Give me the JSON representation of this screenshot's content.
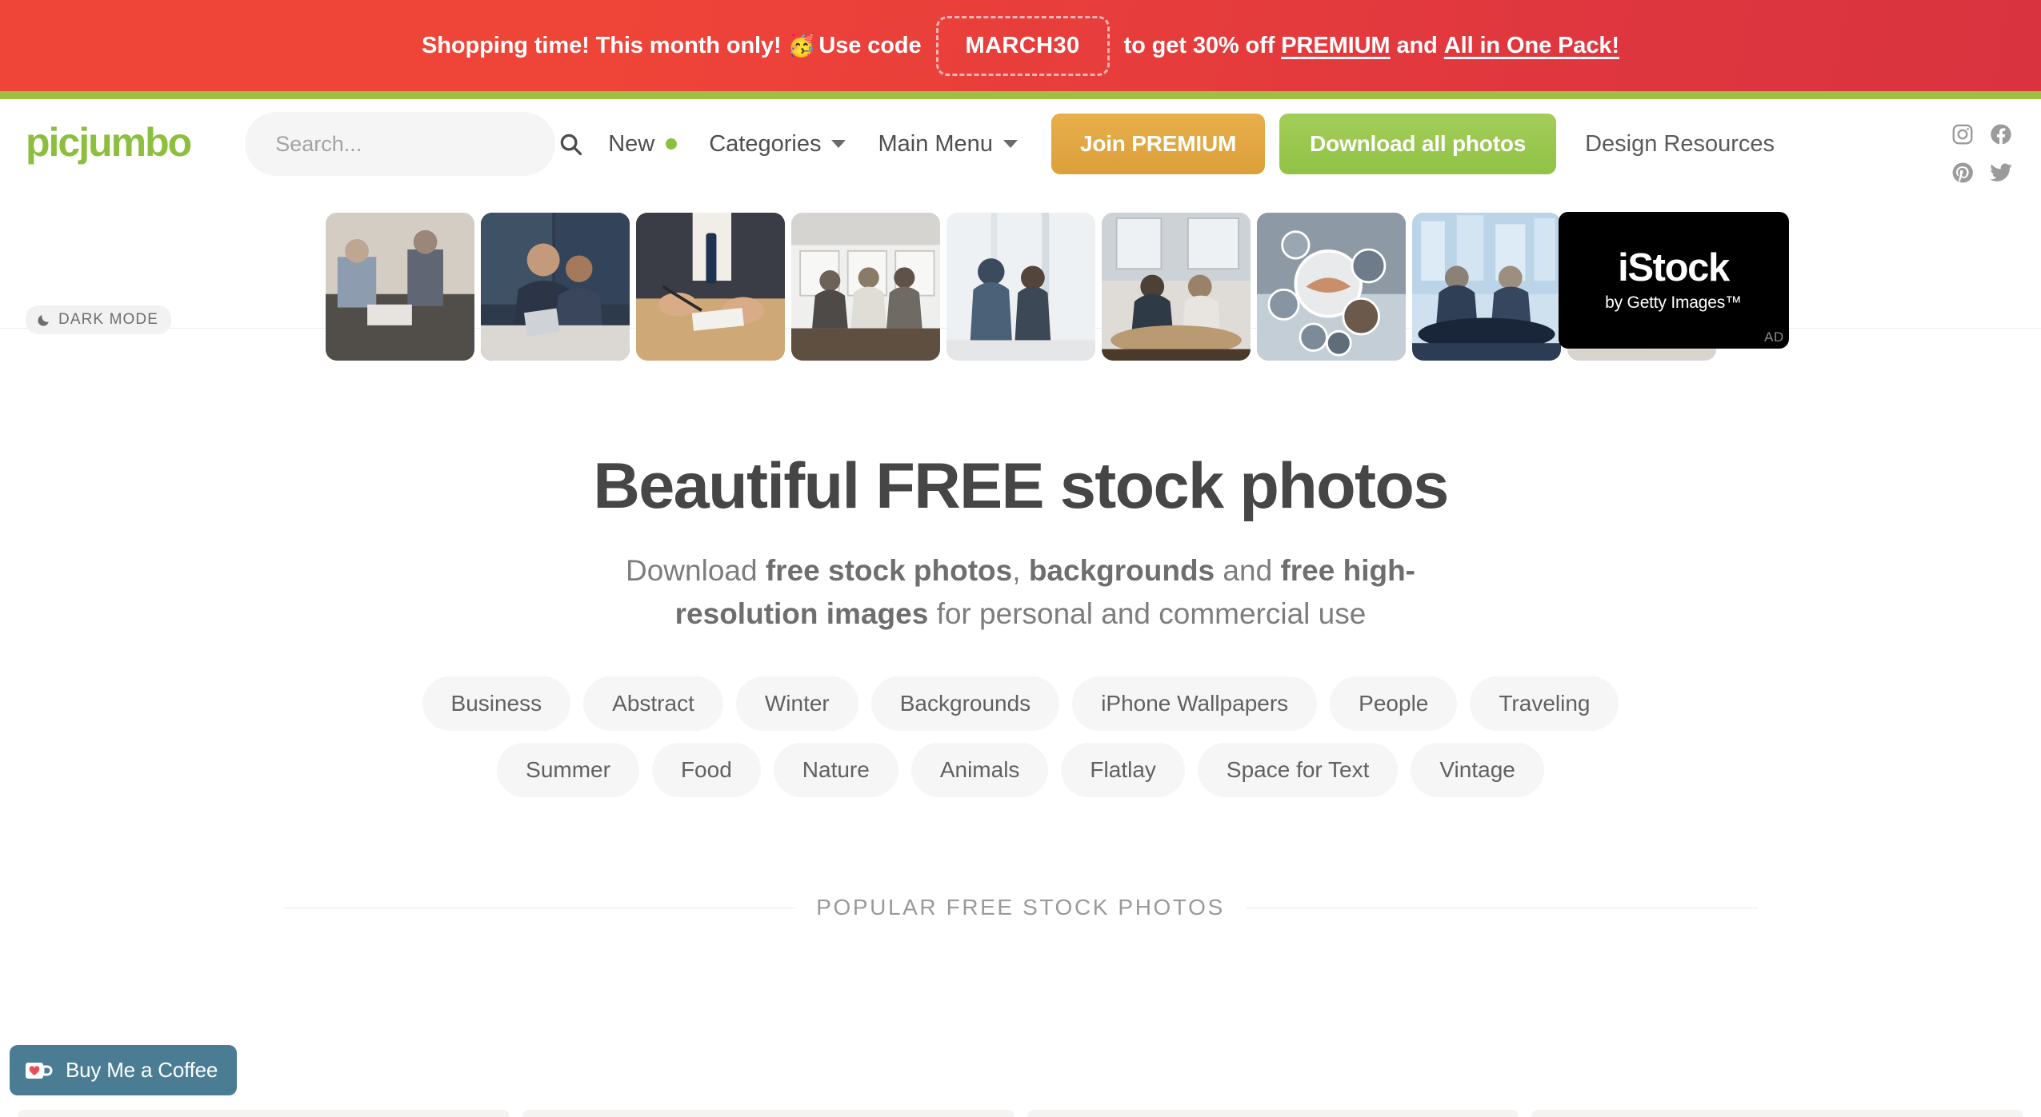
{
  "promo": {
    "text_before": "Shopping time! This month only!",
    "emoji": "🥳",
    "use_code": "Use code",
    "code": "MARCH30",
    "text_middle": "to get 30% off",
    "link_premium": "PREMIUM",
    "text_and": "and",
    "link_pack": "All in One Pack!",
    "bg_color": "#ef4438",
    "accent_bar_color": "#9cc042"
  },
  "header": {
    "logo": "picjumbo",
    "logo_color": "#8dbf3f",
    "search": {
      "placeholder": "Search...",
      "value": "",
      "icon": "search-icon"
    },
    "nav": [
      {
        "label": "New",
        "has_dot": true,
        "has_caret": false
      },
      {
        "label": "Categories",
        "has_dot": false,
        "has_caret": true
      },
      {
        "label": "Main Menu",
        "has_dot": false,
        "has_caret": true
      }
    ],
    "buttons": {
      "premium": "Join PREMIUM",
      "premium_color": "#dfa53f",
      "download": "Download all photos",
      "download_color": "#9ac64c"
    },
    "design_resources": "Design Resources",
    "socials": [
      {
        "name": "instagram-icon"
      },
      {
        "name": "facebook-icon"
      },
      {
        "name": "pinterest-icon"
      },
      {
        "name": "twitter-icon"
      }
    ],
    "dark_mode": {
      "label": "DARK MODE",
      "icon": "moon-icon"
    }
  },
  "ad": {
    "thumbnails": [
      {
        "alt": "business-meeting-laptop"
      },
      {
        "alt": "two-businessmen-tablet"
      },
      {
        "alt": "signing-document-pen"
      },
      {
        "alt": "conference-room-group"
      },
      {
        "alt": "office-window-seated"
      },
      {
        "alt": "boardroom-table-discussion"
      },
      {
        "alt": "network-handshake-bubbles"
      },
      {
        "alt": "executives-glass-table"
      },
      {
        "alt": "desk-paperwork-hands"
      }
    ],
    "sponsor": {
      "name": "iStock",
      "tagline": "by Getty Images™",
      "badge": "AD"
    }
  },
  "hero": {
    "title": "Beautiful FREE stock photos",
    "subtitle": {
      "part1": "Download ",
      "bold1": "free stock photos",
      "part2": ", ",
      "bold2": "backgrounds",
      "part3": " and ",
      "bold3": "free high-resolution images",
      "part4": " for personal and commercial use"
    }
  },
  "tags": {
    "row1": [
      "Business",
      "Abstract",
      "Winter",
      "Backgrounds",
      "iPhone Wallpapers",
      "People",
      "Traveling"
    ],
    "row2": [
      "Summer",
      "Food",
      "Nature",
      "Animals",
      "Flatlay",
      "Space for Text",
      "Vintage"
    ]
  },
  "section": {
    "popular_label": "POPULAR FREE STOCK PHOTOS"
  },
  "bmc": {
    "label": "Buy Me a Coffee",
    "bg_color": "#4a7d94",
    "icon": "coffee-cup-heart-icon"
  }
}
